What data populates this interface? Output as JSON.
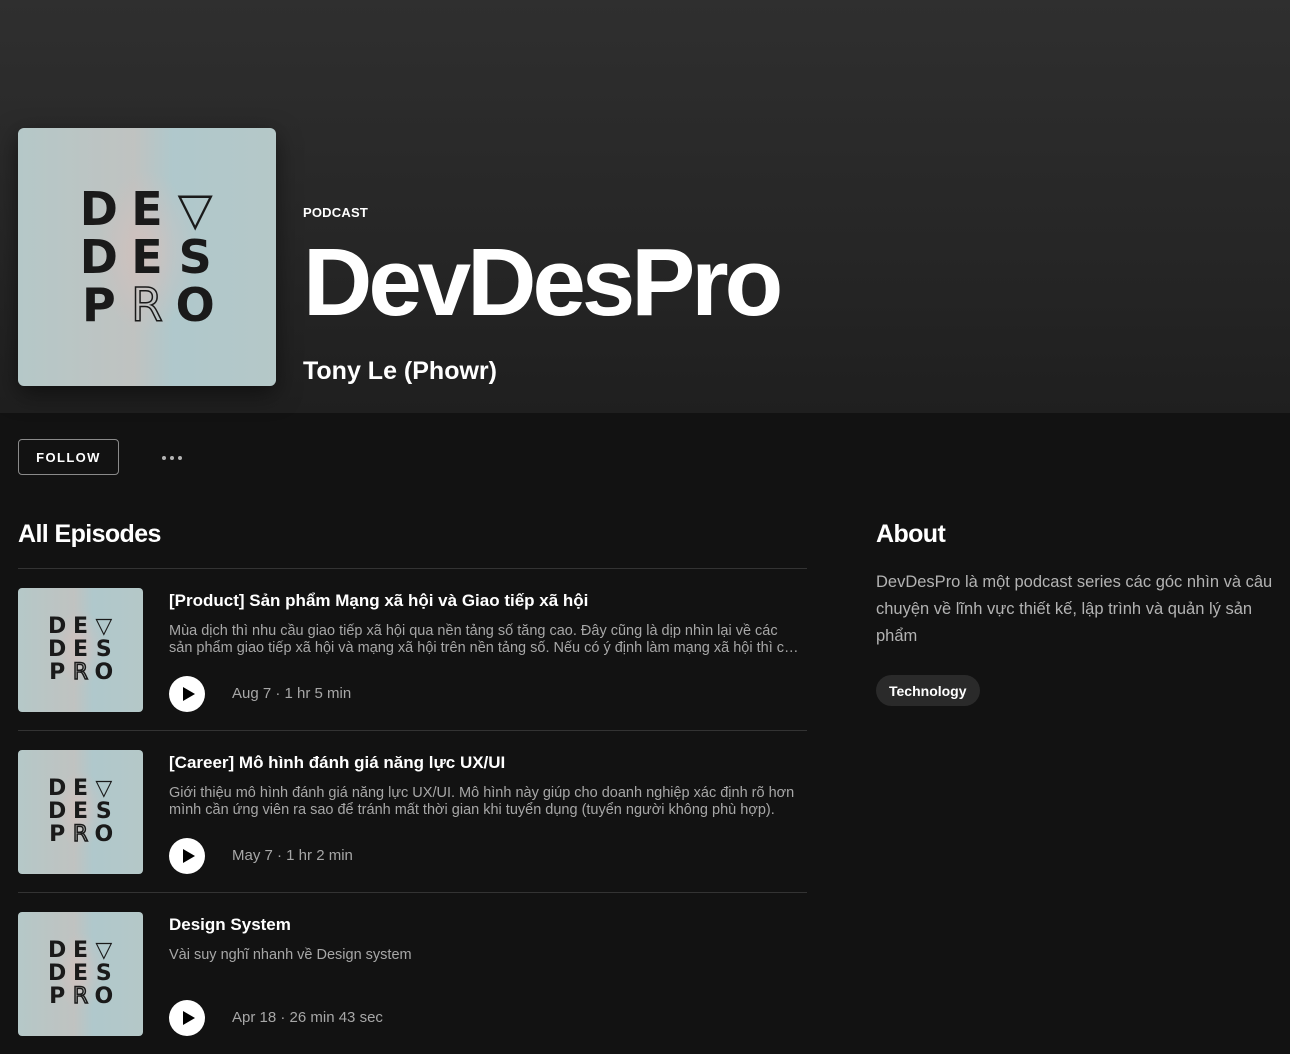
{
  "podcast": {
    "type_label": "PODCAST",
    "title": "DevDesPro",
    "author": "Tony Le (Phowr)",
    "cover_letters": [
      "D",
      "E",
      "▽",
      "D",
      "E",
      "S",
      "P",
      "R",
      "O"
    ]
  },
  "actions": {
    "follow_label": "FOLLOW",
    "more_label": "···"
  },
  "episodes_section": {
    "title": "All Episodes",
    "items": [
      {
        "title": "[Product] Sản phẩm Mạng xã hội và Giao tiếp xã hội",
        "description": "Mùa dịch thì nhu cầu giao tiếp xã hội qua nền tảng số tăng cao. Đây cũng là dịp nhìn lại về các sản phẩm giao tiếp xã hội và mạng xã hội trên nền tảng số. Nếu có ý định làm mạng xã hội thì cần chú ý những gì?",
        "meta": "Aug 7 · 1 hr 5 min"
      },
      {
        "title": "[Career] Mô hình đánh giá năng lực UX/UI",
        "description": "Giới thiệu mô hình đánh giá năng lực UX/UI. Mô hình này giúp cho doanh nghiệp xác định rõ hơn mình cần ứng viên ra sao để tránh mất thời gian khi tuyển dụng (tuyển người không phù hợp).",
        "meta": "May 7 · 1 hr 2 min"
      },
      {
        "title": "Design System",
        "description": "Vài suy nghĩ nhanh về Design system",
        "meta": "Apr 18 · 26 min 43 sec"
      }
    ]
  },
  "about": {
    "title": "About",
    "text": "DevDesPro là một podcast series các góc nhìn và câu chuyện về lĩnh vực thiết kế, lập trình và quản lý sản phẩm",
    "tag": "Technology"
  },
  "colors": {
    "background": "#121212",
    "header_gradient_top": "#2f2f2f",
    "secondary_text": "#a7a7a7",
    "tag_background": "#2a2a2a"
  },
  "icons": {
    "play": "play-icon",
    "more": "more-icon"
  }
}
